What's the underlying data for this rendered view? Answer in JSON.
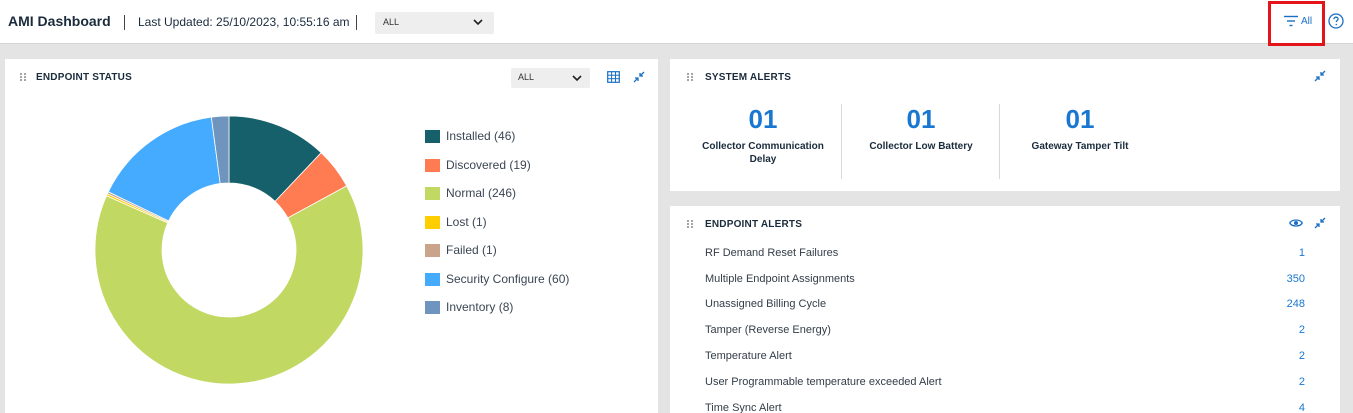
{
  "header": {
    "title": "AMI Dashboard",
    "last_updated": "Last Updated: 25/10/2023, 10:55:16 am",
    "scope_select": "ALL",
    "filter_label": "All"
  },
  "endpoint_status": {
    "title": "ENDPOINT STATUS",
    "select_value": "ALL"
  },
  "chart_data": {
    "type": "pie",
    "categories": [
      "Installed",
      "Discovered",
      "Normal",
      "Lost",
      "Failed",
      "Security Configure",
      "Inventory"
    ],
    "values": [
      46,
      19,
      246,
      1,
      1,
      60,
      8
    ],
    "legend_labels": [
      "Installed (46)",
      "Discovered (19)",
      "Normal (246)",
      "Lost (1)",
      "Failed (1)",
      "Security Configure (60)",
      "Inventory (8)"
    ],
    "colors": [
      "#16606c",
      "#ff7b52",
      "#c1d963",
      "#ffce00",
      "#c9a48a",
      "#45abff",
      "#6f94bd"
    ],
    "donut": true,
    "legend_position": "right"
  },
  "system_alerts": {
    "title": "SYSTEM ALERTS",
    "tiles": [
      {
        "value": "01",
        "label": "Collector Communication Delay"
      },
      {
        "value": "01",
        "label": "Collector Low Battery"
      },
      {
        "value": "01",
        "label": "Gateway Tamper Tilt"
      }
    ]
  },
  "endpoint_alerts": {
    "title": "ENDPOINT ALERTS",
    "rows": [
      {
        "label": "RF Demand Reset Failures",
        "count": "1"
      },
      {
        "label": "Multiple Endpoint Assignments",
        "count": "350"
      },
      {
        "label": "Unassigned Billing Cycle",
        "count": "248"
      },
      {
        "label": "Tamper (Reverse Energy)",
        "count": "2"
      },
      {
        "label": "Temperature Alert",
        "count": "2"
      },
      {
        "label": "User Programmable temperature exceeded Alert",
        "count": "2"
      },
      {
        "label": "Time Sync Alert",
        "count": "4"
      }
    ]
  }
}
